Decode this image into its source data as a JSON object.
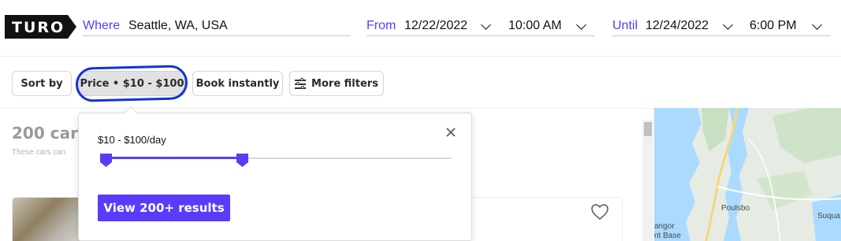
{
  "brand": {
    "logo_text": "TURO",
    "accent": "#593cfb",
    "dark": "#121214"
  },
  "search": {
    "where_label": "Where",
    "where_value": "Seattle, WA, USA",
    "from_label": "From",
    "from_date": "12/22/2022",
    "from_time": "10:00 AM",
    "until_label": "Until",
    "until_date": "12/24/2022",
    "until_time": "6:00 PM"
  },
  "filters": {
    "sort_by": "Sort by",
    "price": "Price • $10 - $100",
    "book_instantly": "Book instantly",
    "more_filters": "More filters",
    "annotation_color": "#1432d8"
  },
  "results": {
    "count": "200 cars",
    "subtitle": "These cars can"
  },
  "price_popup": {
    "range_label": "$10 - $100/day",
    "slider_min_fraction": 0,
    "slider_max_fraction": 0.36,
    "cta_label": "View 200+ results"
  },
  "map": {
    "labels": [
      "Poulsbo",
      "Suqua",
      "angor",
      "nt Base"
    ]
  }
}
